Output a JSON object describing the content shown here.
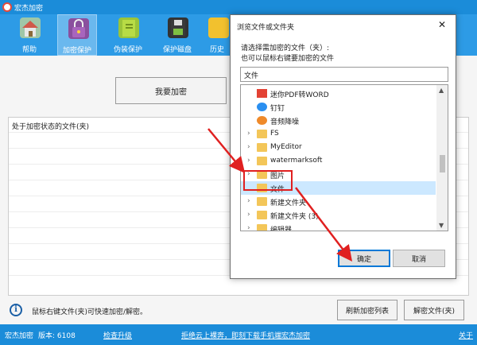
{
  "app": {
    "title": "宏杰加密"
  },
  "toolbar": {
    "items": [
      {
        "label": "帮助",
        "icon": "house-icon",
        "active": false
      },
      {
        "label": "加密保护",
        "icon": "lock-bag-icon",
        "active": true
      },
      {
        "label": "伪装保护",
        "icon": "book-icon",
        "active": false
      },
      {
        "label": "保护磁盘",
        "icon": "floppy-disk-icon",
        "active": false
      },
      {
        "label": "历史",
        "icon": "history-icon",
        "active": false
      }
    ]
  },
  "main": {
    "encrypt_button": "我要加密",
    "list_header": "处于加密状态的文件(夹)",
    "info_text": "鼠标右键文件(夹)可快速加密/解密。",
    "refresh_button": "刷新加密列表",
    "decrypt_button": "解密文件(夹)"
  },
  "statusbar": {
    "app_name": "宏杰加密",
    "version": "版本: 6108",
    "upgrade": "检查升级",
    "promo": "拒绝云上裸奔，即刻下载手机端宏杰加密",
    "about": "关于"
  },
  "dialog": {
    "title": "浏览文件或文件夹",
    "close": "✕",
    "desc_line1": "请选择需加密的文件（夹）:",
    "desc_line2": "也可以鼠标右键要加密的文件",
    "path_value": "文件",
    "tree": [
      {
        "name": "迷你PDF转WORD",
        "icon": "pdf-app-icon",
        "caret": false
      },
      {
        "name": "钉钉",
        "icon": "dingtalk-icon",
        "caret": false
      },
      {
        "name": "音频降噪",
        "icon": "audio-app-icon",
        "caret": false
      },
      {
        "name": "FS",
        "icon": "folder-icon",
        "caret": true
      },
      {
        "name": "MyEditor",
        "icon": "folder-icon",
        "caret": true
      },
      {
        "name": "watermarksoft",
        "icon": "folder-icon",
        "caret": true
      },
      {
        "name": "图片",
        "icon": "folder-icon",
        "caret": true
      },
      {
        "name": "文件",
        "icon": "folder-icon",
        "caret": false,
        "selected": true
      },
      {
        "name": "新建文件夹",
        "icon": "folder-icon",
        "caret": true
      },
      {
        "name": "新建文件夹 (3)",
        "icon": "folder-icon",
        "caret": true
      },
      {
        "name": "编辑器",
        "icon": "folder-icon",
        "caret": true
      }
    ],
    "ok_button": "确定",
    "cancel_button": "取消"
  },
  "colors": {
    "titlebar": "#1b8cd9",
    "toolbar": "#2d9be6",
    "annotation_red": "#e02020",
    "selection": "#cce8ff"
  }
}
